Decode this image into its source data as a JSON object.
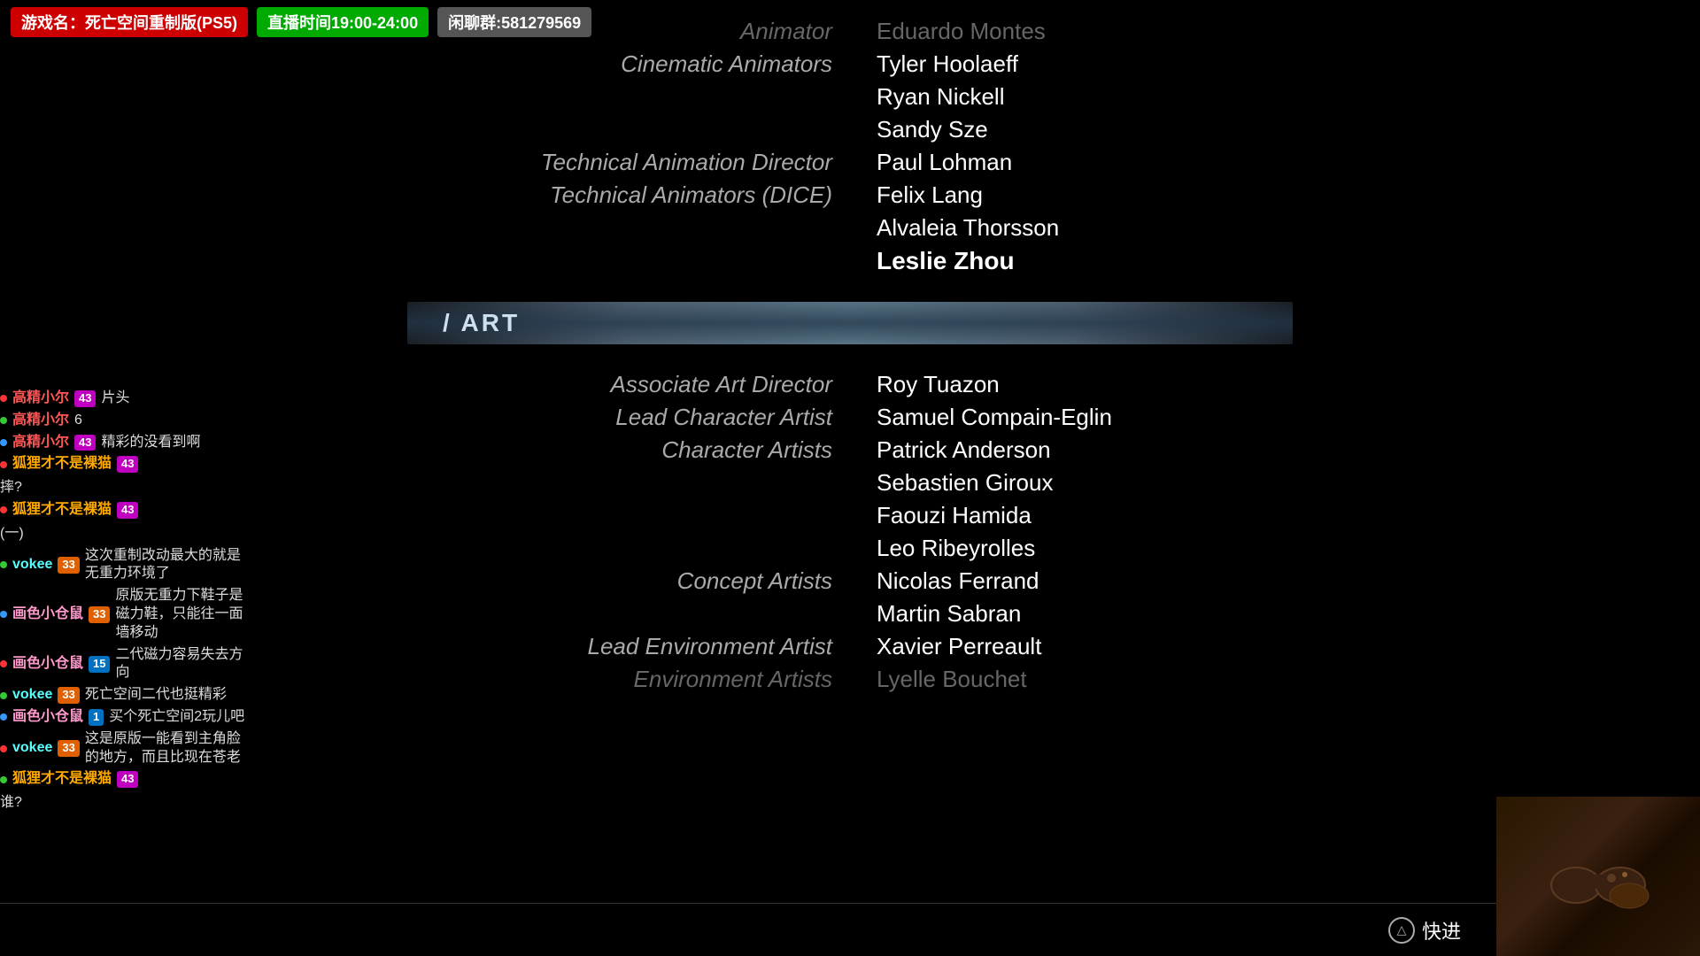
{
  "topbar": {
    "game_label": "游戏名：死亡空间重制版(PS5)",
    "stream_time": "直播时间19:00-24:00",
    "group": "闲聊群:581279569"
  },
  "credits": {
    "section_divider_label": "/ ART",
    "rows_before": [
      {
        "role": "Animator",
        "name": "Eduardo Montes",
        "role_faded": true,
        "name_faded": true
      },
      {
        "role": "Cinematic Animators",
        "name": "Tyler Hoolaeff",
        "role_faded": false,
        "name_faded": false
      },
      {
        "role": "",
        "name": "Ryan Nickell",
        "role_faded": false,
        "name_faded": false
      },
      {
        "role": "",
        "name": "Sandy Sze",
        "role_faded": false,
        "name_faded": false
      },
      {
        "role": "Technical Animation Director",
        "name": "Paul Lohman",
        "role_faded": false,
        "name_faded": false
      },
      {
        "role": "Technical Animators (DICE)",
        "name": "Felix Lang",
        "role_faded": false,
        "name_faded": false
      },
      {
        "role": "",
        "name": "Alvaleia Thorsson",
        "role_faded": false,
        "name_faded": false
      },
      {
        "role": "",
        "name": "Leslie Zhou",
        "bold": true,
        "role_faded": false,
        "name_faded": false
      }
    ],
    "rows_after": [
      {
        "role": "Associate Art Director",
        "name": "Roy Tuazon",
        "role_faded": false,
        "name_faded": false
      },
      {
        "role": "Lead Character Artist",
        "name": "Samuel Compain-Eglin",
        "role_faded": false,
        "name_faded": false
      },
      {
        "role": "Character Artists",
        "name": "Patrick Anderson",
        "role_faded": false,
        "name_faded": false
      },
      {
        "role": "",
        "name": "Sebastien Giroux",
        "role_faded": false,
        "name_faded": false
      },
      {
        "role": "",
        "name": "Faouzi Hamida",
        "role_faded": false,
        "name_faded": false
      },
      {
        "role": "",
        "name": "Leo Ribeyrolles",
        "role_faded": false,
        "name_faded": false
      },
      {
        "role": "Concept Artists",
        "name": "Nicolas Ferrand",
        "role_faded": false,
        "name_faded": false
      },
      {
        "role": "",
        "name": "Martin Sabran",
        "role_faded": false,
        "name_faded": false
      },
      {
        "role": "Lead Environment Artist",
        "name": "Xavier Perreault",
        "role_faded": false,
        "name_faded": false
      },
      {
        "role": "Environment Artists",
        "name": "Lyelle Bouchet",
        "role_faded": false,
        "name_faded": true
      }
    ]
  },
  "chat": {
    "messages": [
      {
        "dot_color": "red",
        "user": "高精小尔",
        "user_color": "red",
        "badge": "43",
        "badge_class": "badge-num-43",
        "text": "片头"
      },
      {
        "dot_color": "green",
        "user": "高精小尔",
        "user_color": "red",
        "badge": "",
        "badge_class": "",
        "text": "6"
      },
      {
        "dot_color": "blue",
        "user": "高精小尔",
        "user_color": "red",
        "badge": "43",
        "badge_class": "badge-num-43",
        "text": "精彩的没看到啊"
      },
      {
        "dot_color": "red",
        "user": "狐狸才不是裸猫",
        "user_color": "orange",
        "badge": "43",
        "badge_class": "badge-num-43",
        "text": "摔?"
      },
      {
        "dot_color": "red",
        "user": "狐狸才不是裸猫",
        "user_color": "orange",
        "badge": "43",
        "badge_class": "badge-num-43",
        "text": "(一)"
      },
      {
        "dot_color": "green",
        "user": "vokee",
        "user_color": "cyan",
        "badge": "33",
        "badge_class": "badge-num-33",
        "text": "这次重制改动最大的就是无重力环境了"
      },
      {
        "dot_color": "blue",
        "user": "画色小仓鼠",
        "user_color": "pink",
        "badge": "33",
        "badge_class": "badge-num-33",
        "text": "原版无重力下鞋子是磁力鞋，只能往一面墙移动"
      },
      {
        "dot_color": "red",
        "user": "画色小仓鼠",
        "user_color": "pink",
        "badge": "15",
        "badge_class": "badge-num-15",
        "text": "二代磁力容易失去方向"
      },
      {
        "dot_color": "green",
        "user": "vokee",
        "user_color": "cyan",
        "badge": "33",
        "badge_class": "badge-num-33",
        "text": "死亡空间二代也挺精彩"
      },
      {
        "dot_color": "blue",
        "user": "画色小仓鼠",
        "user_color": "pink",
        "badge": "1",
        "badge_class": "badge-num-1",
        "text": "买个死亡空间2玩儿吧"
      },
      {
        "dot_color": "red",
        "user": "vokee",
        "user_color": "cyan",
        "badge": "33",
        "badge_class": "badge-num-33",
        "text": "这是原版一能看到主角脸的地方，而且比现在苍老"
      },
      {
        "dot_color": "green",
        "user": "狐狸才不是裸猫",
        "user_color": "orange",
        "badge": "43",
        "badge_class": "badge-num-43",
        "text": "谁?"
      }
    ]
  },
  "bottom": {
    "fast_forward_label": "快进",
    "triangle_symbol": "△"
  }
}
